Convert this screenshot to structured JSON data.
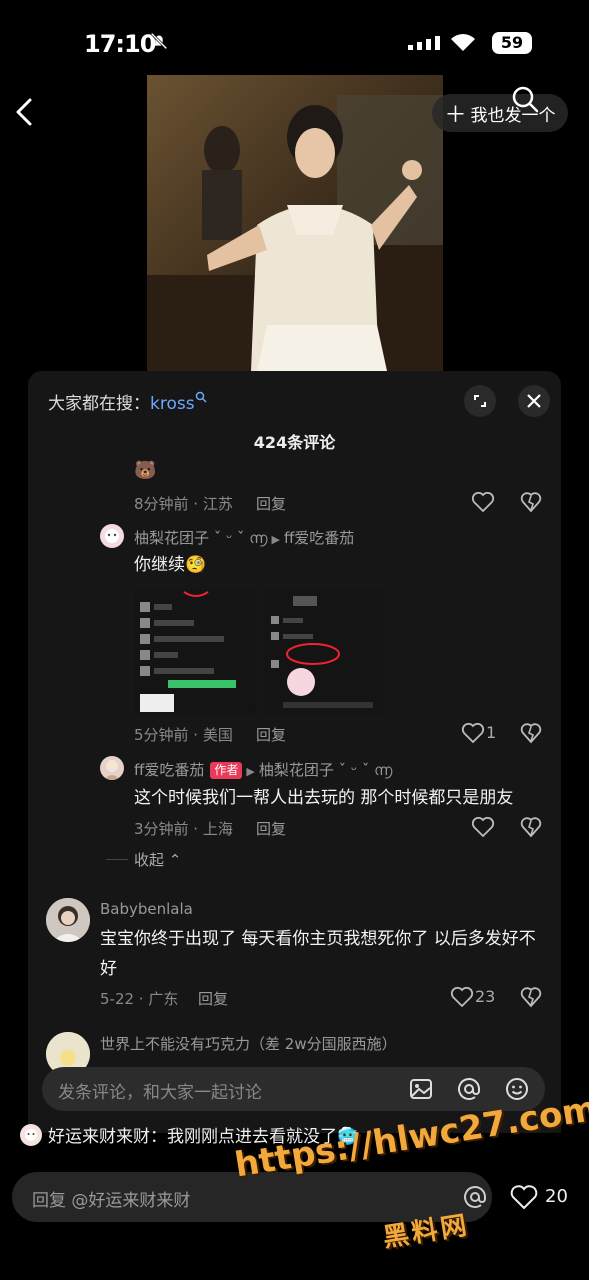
{
  "status_bar": {
    "time": "17:10",
    "battery": "59"
  },
  "nav": {
    "post_label": "我也发一个"
  },
  "panel": {
    "search_prefix": "大家都在搜：",
    "search_keyword": "kross",
    "title": "424条评论"
  },
  "comments": {
    "c0": {
      "emoji": "🐻",
      "meta": "8分钟前 · 江苏",
      "reply": "回复"
    },
    "c1": {
      "name": "柚梨花团子 ˇ ᵕ ˇ ൬",
      "to": "ff爱吃番茄",
      "text": "你继续🧐",
      "meta": "5分钟前 · 美国",
      "reply": "回复",
      "likes": "1"
    },
    "c2": {
      "name": "ff爱吃番茄",
      "badge": "作者",
      "to": "柚梨花团子 ˇ ᵕ ˇ ൬",
      "text": "这个时候我们一帮人出去玩的 那个时候都只是朋友",
      "meta": "3分钟前 · 上海",
      "reply": "回复"
    },
    "collapse": "收起",
    "c3": {
      "name": "Babybenlala",
      "text": "宝宝你终于出现了 每天看你主页我想死你了 以后多发好不好",
      "meta": "5-22 · 广东",
      "reply": "回复",
      "likes": "23"
    },
    "c4": {
      "name": "世界上不能没有巧克力（差 2w分国服西施）"
    }
  },
  "input": {
    "placeholder": "发条评论，和大家一起讨论"
  },
  "live": {
    "user": "好运来财来财",
    "text": "：我刚刚点进去看就没了🥶"
  },
  "reply_bar": {
    "placeholder": "回复 @好运来财来财",
    "likes": "20"
  },
  "watermark": {
    "url": "https://hlwc27.com",
    "name": "黑料网"
  },
  "colors": {
    "accent_blue": "#6aa9ff",
    "author_badge": "#ea3a5a",
    "watermark": "#f3a83b"
  }
}
